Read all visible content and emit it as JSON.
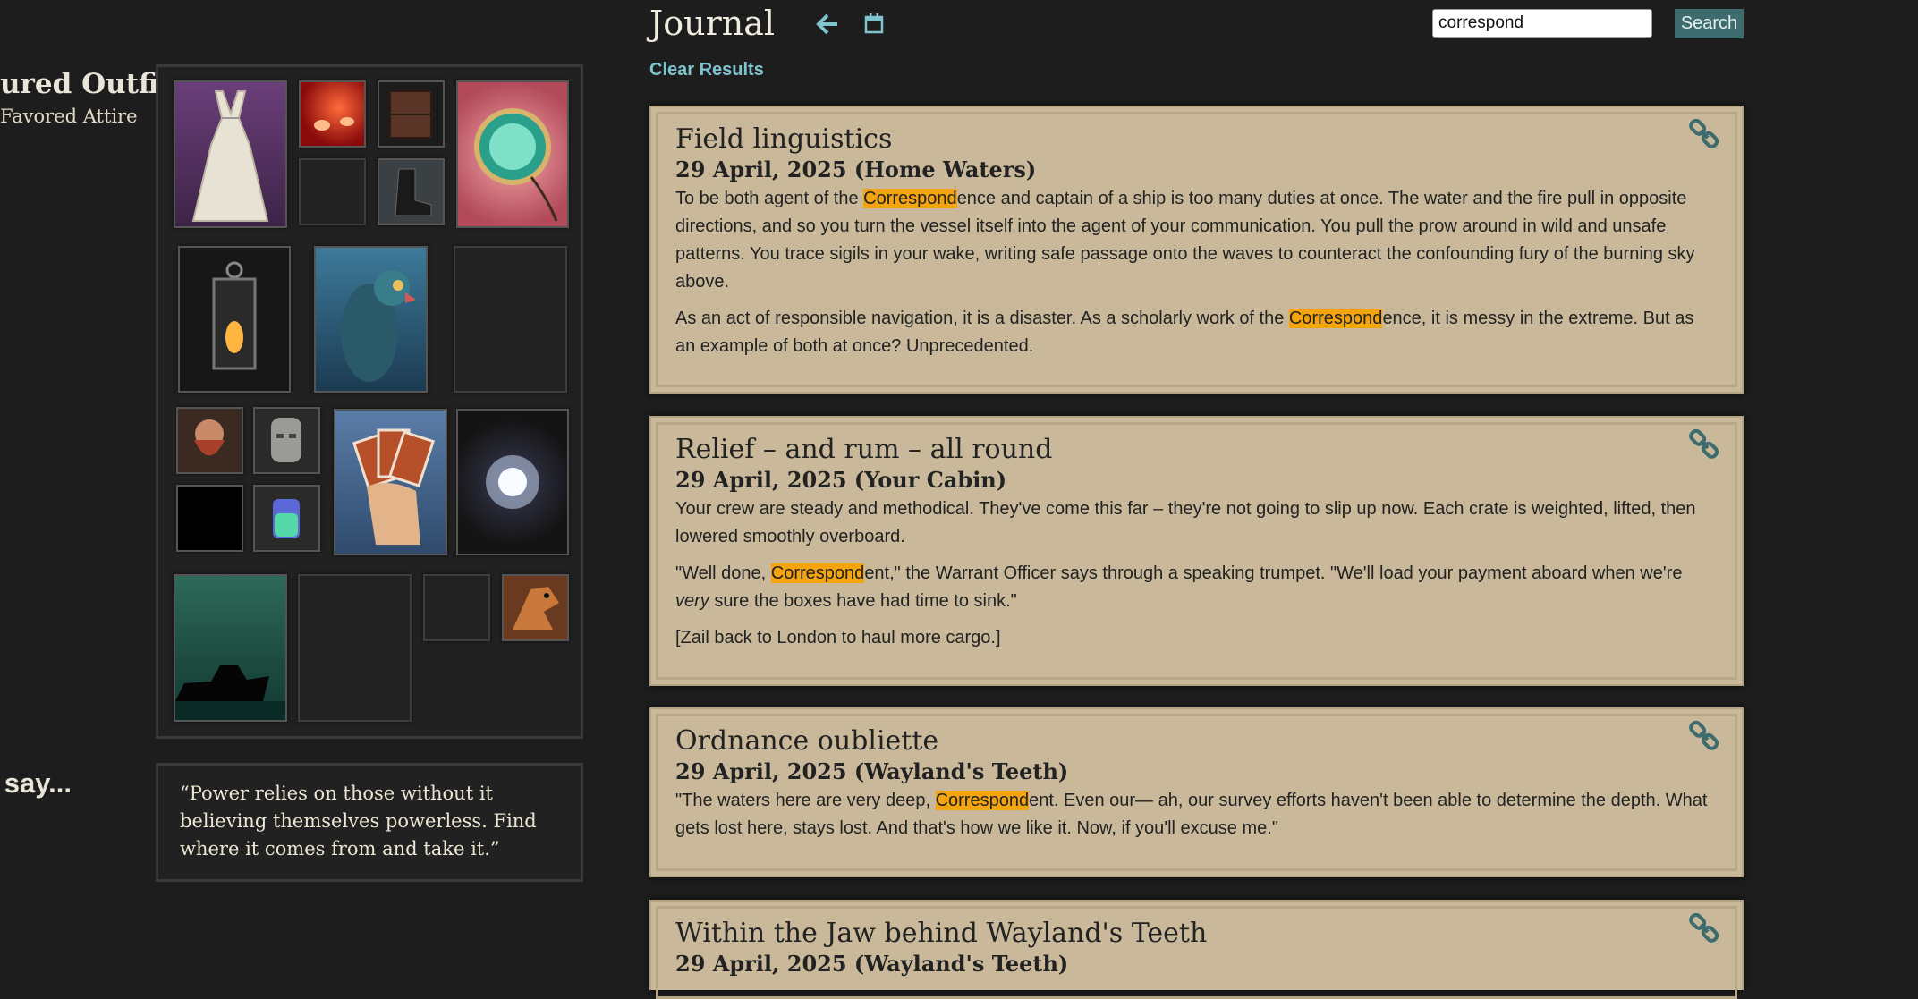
{
  "outfit": {
    "title": "ured Outfit",
    "subtitle": "Favored Attire"
  },
  "say_heading": "say...",
  "quote": "“Power relies on those without it believing themselves powerless. Find where it comes from and take it.”",
  "header": {
    "title": "Journal",
    "back_icon": "arrow-left-icon",
    "calendar_icon": "calendar-icon",
    "search_value": "correspond",
    "search_label": "Search",
    "clear_label": "Clear Results"
  },
  "entries": [
    {
      "title": "Field linguistics",
      "date": "29 April, 2025  (Home Waters)",
      "p1_a": "To be both agent of the ",
      "p1_hl": "Correspond",
      "p1_b": "ence and captain of a ship is too many duties at once. The water and the fire pull in opposite directions, and so you turn the vessel itself into the agent of your communication. You pull the prow around in wild and unsafe patterns. You trace sigils in your wake, writing safe passage onto the waves to counteract the confounding fury of the burning sky above.",
      "p2_a": "As an act of responsible navigation, it is a disaster. As a scholarly work of the ",
      "p2_hl": "Correspond",
      "p2_b": "ence, it is messy in the extreme. But as an example of both at once? Unprecedented."
    },
    {
      "title": "Relief – and rum – all round",
      "date": "29 April, 2025  (Your Cabin)",
      "p1": "Your crew are steady and methodical. They've come this far – they're not going to slip up now. Each crate is weighted, lifted, then lowered smoothly overboard.",
      "p2_a": "\"Well done, ",
      "p2_hl": "Correspond",
      "p2_b": "ent,\" the Warrant Officer says through a speaking trumpet. \"We'll load your payment aboard when we're ",
      "p2_em": "very",
      "p2_c": " sure the boxes have had time to sink.\"",
      "p3": "[Zail back to London to haul more cargo.]"
    },
    {
      "title": "Ordnance oubliette",
      "date": "29 April, 2025  (Wayland's Teeth)",
      "p1_a": "\"The waters here are very deep, ",
      "p1_hl": "Correspond",
      "p1_b": "ent. Even our— ah, our survey efforts haven't been able to determine the depth. What gets lost here, stays lost. And that's how we like it. Now, if you'll excuse me.\""
    },
    {
      "title": "Within the Jaw behind Wayland's Teeth",
      "date": "29 April, 2025  (Wayland's Teeth)"
    }
  ],
  "equipment_slots": [
    {
      "name": "dress-slot",
      "icon": "white-dress-icon",
      "filled": true
    },
    {
      "name": "flame-slot",
      "icon": "red-flame-icon",
      "filled": true
    },
    {
      "name": "crate-slot",
      "icon": "wooden-crate-icon",
      "filled": true
    },
    {
      "name": "amulet-slot",
      "icon": "green-amulet-icon",
      "filled": true
    },
    {
      "name": "empty-small-slot",
      "icon": "",
      "filled": false
    },
    {
      "name": "boot-slot",
      "icon": "boot-icon",
      "filled": true
    },
    {
      "name": "lantern-slot",
      "icon": "lantern-icon",
      "filled": true
    },
    {
      "name": "parrot-slot",
      "icon": "parrot-icon",
      "filled": true
    },
    {
      "name": "empty-medium-slot",
      "icon": "",
      "filled": false
    },
    {
      "name": "bearded-man-slot",
      "icon": "bearded-man-icon",
      "filled": true
    },
    {
      "name": "stone-head-slot",
      "icon": "stone-head-icon",
      "filled": true
    },
    {
      "name": "cards-slot",
      "icon": "playing-cards-icon",
      "filled": true
    },
    {
      "name": "light-slot",
      "icon": "glowing-light-icon",
      "filled": true
    },
    {
      "name": "black-slot",
      "icon": "black-square-icon",
      "filled": true
    },
    {
      "name": "jar-slot",
      "icon": "glowing-jar-icon",
      "filled": true
    },
    {
      "name": "ship-slot",
      "icon": "ship-silhouette-icon",
      "filled": true
    },
    {
      "name": "empty-large-slot",
      "icon": "",
      "filled": false
    },
    {
      "name": "empty-small-slot-2",
      "icon": "",
      "filled": false
    },
    {
      "name": "hound-slot",
      "icon": "hound-icon",
      "filled": true
    }
  ],
  "colors": {
    "background": "#1d1d1d",
    "card": "#c9b99a",
    "highlight": "#f4a40e",
    "accent_teal": "#3e6b6d",
    "link": "#7fc3cf"
  }
}
